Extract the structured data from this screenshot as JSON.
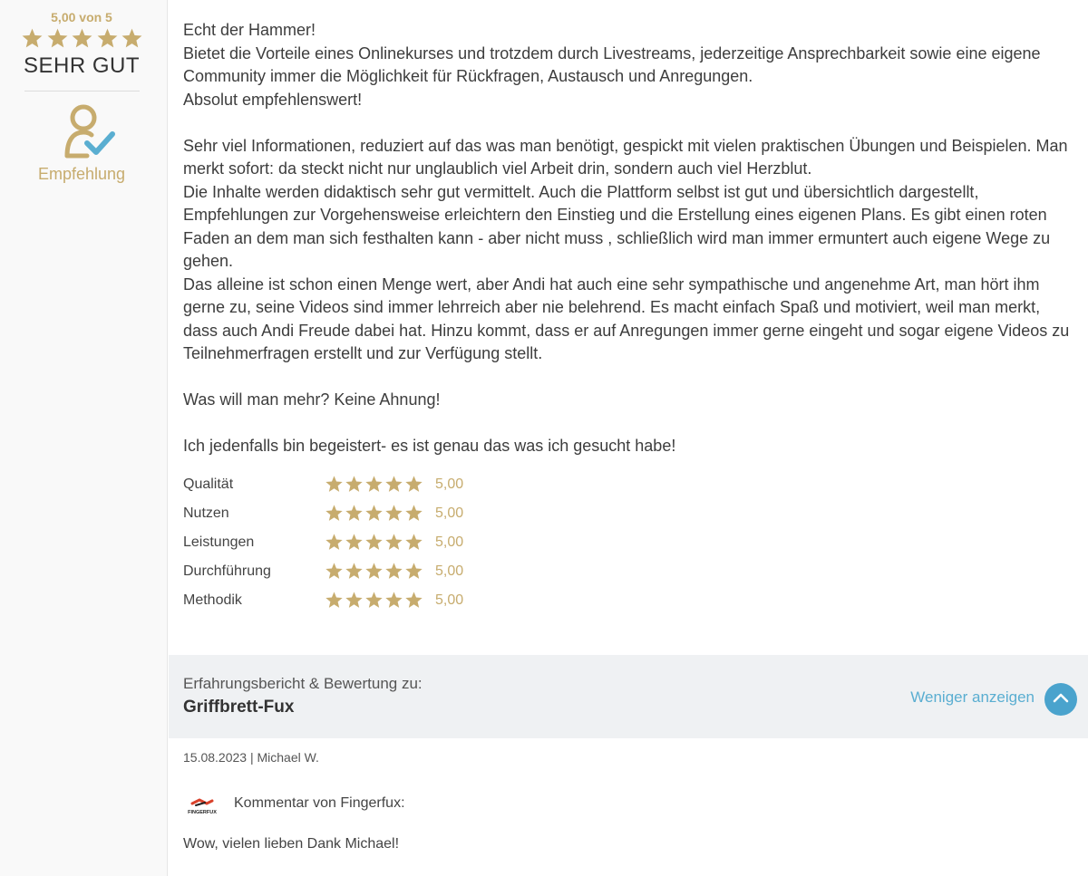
{
  "sidebar": {
    "score_text": "5,00 von 5",
    "stars": 5,
    "verdict": "SEHR GUT",
    "recommendation_icon": "user-check-icon",
    "recommendation_label": "Empfehlung"
  },
  "review": {
    "paragraphs": [
      "Echt der Hammer!",
      "Bietet die Vorteile eines Onlinekurses und trotzdem durch Livestreams, jederzeitige Ansprechbarkeit sowie eine eigene Community immer die Möglichkeit für Rückfragen, Austausch und Anregungen.",
      "Absolut empfehlenswert!",
      "",
      "Sehr viel Informationen, reduziert auf das was man benötigt, gespickt mit vielen praktischen Übungen und Beispielen. Man merkt sofort: da steckt nicht nur unglaublich viel Arbeit drin, sondern auch viel Herzblut.",
      "Die Inhalte werden didaktisch sehr gut vermittelt. Auch die Plattform selbst ist gut und übersichtlich dargestellt, Empfehlungen zur Vorgehensweise erleichtern den Einstieg und die Erstellung eines eigenen Plans. Es gibt einen roten Faden an dem man sich festhalten kann - aber nicht muss , schließlich wird man immer ermuntert auch eigene Wege zu gehen.",
      "Das alleine ist schon einen Menge wert, aber Andi hat auch eine sehr sympathische und angenehme Art, man hört ihm gerne zu, seine Videos sind immer lehrreich aber nie belehrend. Es macht einfach Spaß und motiviert, weil man merkt, dass auch Andi Freude dabei hat. Hinzu kommt, dass er auf Anregungen immer gerne eingeht und sogar eigene Videos zu Teilnehmerfragen erstellt und zur Verfügung stellt.",
      "",
      "Was will man mehr? Keine Ahnung!",
      "",
      "Ich jedenfalls bin begeistert- es ist genau das was ich gesucht habe!"
    ]
  },
  "ratings": [
    {
      "label": "Qualität",
      "stars": 5,
      "value": "5,00"
    },
    {
      "label": "Nutzen",
      "stars": 5,
      "value": "5,00"
    },
    {
      "label": "Leistungen",
      "stars": 5,
      "value": "5,00"
    },
    {
      "label": "Durchführung",
      "stars": 5,
      "value": "5,00"
    },
    {
      "label": "Methodik",
      "stars": 5,
      "value": "5,00"
    }
  ],
  "footer": {
    "about_label": "Erfahrungsbericht & Bewertung zu:",
    "product_name": "Griffbrett-Fux",
    "less_link": "Weniger anzeigen",
    "collapse_icon": "chevron-up-icon"
  },
  "meta": {
    "date_author": "15.08.2023 | Michael W."
  },
  "comment": {
    "logo_text": "FINGERFUX",
    "heading": "Kommentar von Fingerfux:",
    "body": "Wow, vielen lieben Dank Michael!"
  },
  "colors": {
    "gold": "#c7ac6e",
    "link_blue": "#5aaed1",
    "button_blue": "#4aa3cd",
    "footer_bg": "#eff1f3"
  }
}
